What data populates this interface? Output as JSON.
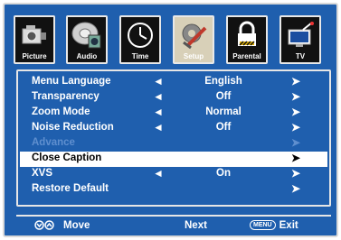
{
  "tabs": [
    {
      "label": "Picture",
      "icon": "camera-icon",
      "active": false
    },
    {
      "label": "Audio",
      "icon": "speaker-disc-icon",
      "active": false
    },
    {
      "label": "Time",
      "icon": "clock-icon",
      "active": false
    },
    {
      "label": "Setup",
      "icon": "tools-icon",
      "active": true
    },
    {
      "label": "Parental",
      "icon": "lock-icon",
      "active": false
    },
    {
      "label": "TV",
      "icon": "tv-antenna-icon",
      "active": false
    }
  ],
  "rows": [
    {
      "name": "Menu Language",
      "value": "English",
      "left": "◄",
      "right": "➤",
      "state": "normal"
    },
    {
      "name": "Transparency",
      "value": "Off",
      "left": "◄",
      "right": "➤",
      "state": "normal"
    },
    {
      "name": "Zoom Mode",
      "value": "Normal",
      "left": "◄",
      "right": "➤",
      "state": "normal"
    },
    {
      "name": "Noise Reduction",
      "value": "Off",
      "left": "◄",
      "right": "➤",
      "state": "normal"
    },
    {
      "name": "Advance",
      "value": "",
      "left": "",
      "right": "➤",
      "state": "dim"
    },
    {
      "name": "Close Caption",
      "value": "",
      "left": "",
      "right": "➤",
      "state": "selected"
    },
    {
      "name": "XVS",
      "value": "On",
      "left": "◄",
      "right": "➤",
      "state": "normal"
    },
    {
      "name": "Restore Default",
      "value": "",
      "left": "",
      "right": "➤",
      "state": "normal"
    }
  ],
  "footer": {
    "move_label": "Move",
    "next_label": "Next",
    "menu_pill": "MENU",
    "exit_label": "Exit"
  }
}
